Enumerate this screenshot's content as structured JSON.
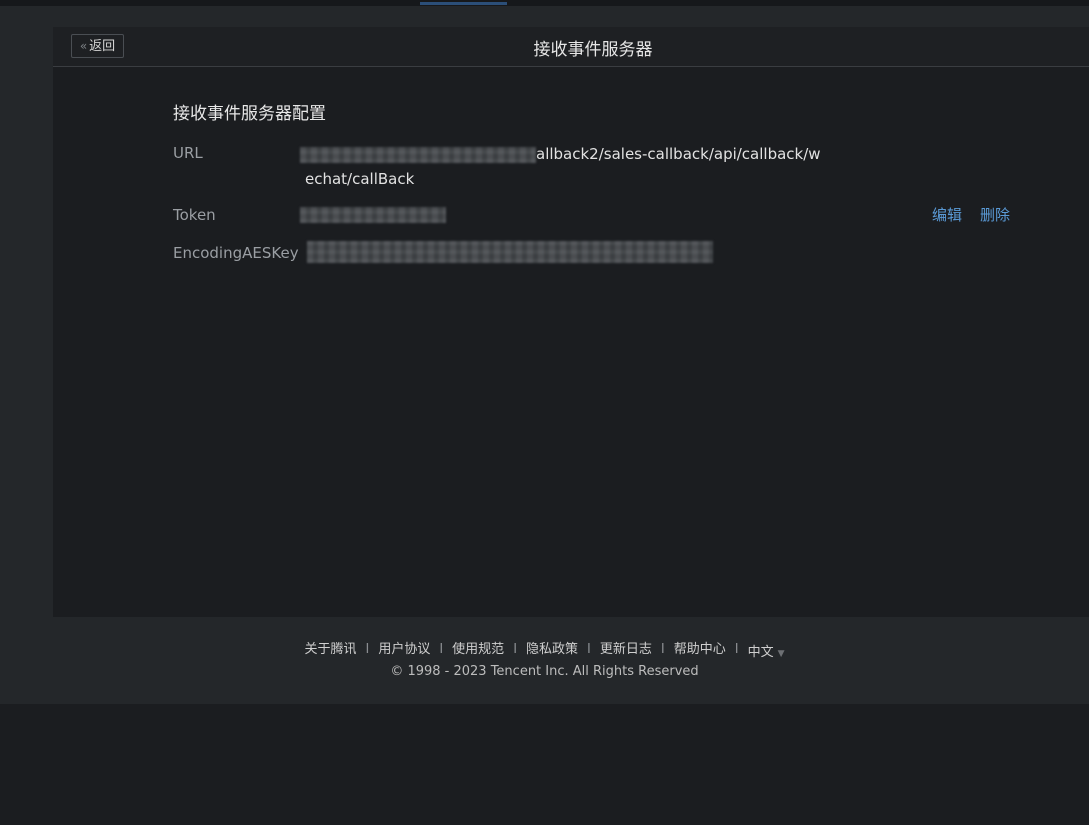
{
  "header": {
    "back_label": "返回",
    "title": "接收事件服务器"
  },
  "config": {
    "section_title": "接收事件服务器配置",
    "url": {
      "label": "URL",
      "value_line1": "allback2/sales-callback/api/callback/w",
      "value_line2": "echat/callBack"
    },
    "token": {
      "label": "Token"
    },
    "aes_key": {
      "label": "EncodingAESKey"
    },
    "actions": {
      "edit": "编辑",
      "delete": "删除"
    }
  },
  "footer": {
    "links": [
      "关于腾讯",
      "用户协议",
      "使用规范",
      "隐私政策",
      "更新日志",
      "帮助中心"
    ],
    "separator": "I",
    "language": "中文",
    "copyright": "© 1998 - 2023 Tencent Inc. All Rights Reserved"
  },
  "colors": {
    "accent_link": "#5a9ad6",
    "background": "#1b1d20"
  }
}
